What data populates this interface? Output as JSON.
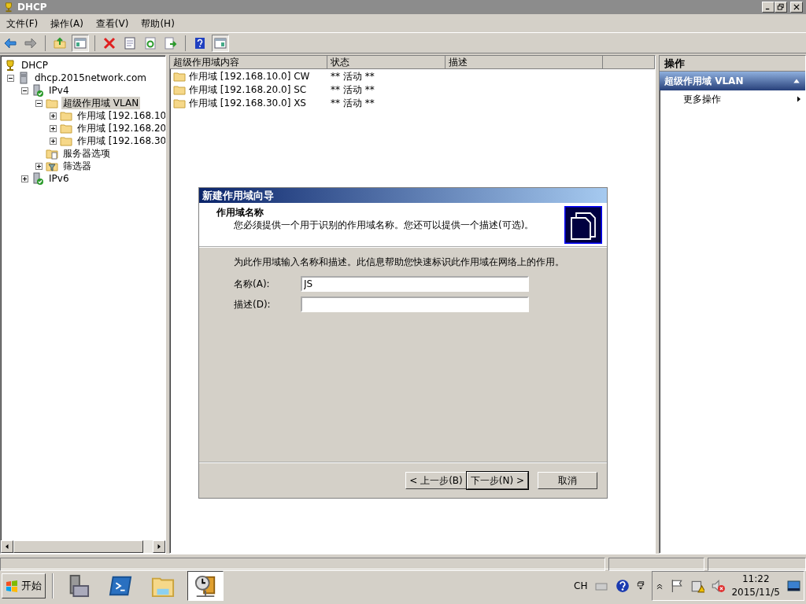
{
  "window": {
    "title": "DHCP"
  },
  "menu": [
    {
      "label": "文件(F)"
    },
    {
      "label": "操作(A)"
    },
    {
      "label": "查看(V)"
    },
    {
      "label": "帮助(H)"
    }
  ],
  "toolbar": [
    {
      "kind": "back",
      "on": false
    },
    {
      "kind": "forward",
      "on": false
    },
    {
      "kind": "up",
      "on": false
    },
    {
      "kind": "tree",
      "on": true
    },
    {
      "kind": "delete",
      "on": false
    },
    {
      "kind": "properties",
      "on": false
    },
    {
      "kind": "refresh",
      "on": false
    },
    {
      "kind": "export",
      "on": false
    },
    {
      "kind": "help",
      "on": false
    },
    {
      "kind": "pane",
      "on": true
    }
  ],
  "tree": [
    {
      "label": "DHCP",
      "kind": "dhcp",
      "selected": false,
      "children": [
        {
          "label": "dhcp.2015network.com",
          "kind": "server",
          "expanded": true,
          "selected": false,
          "children": [
            {
              "label": "IPv4",
              "kind": "protocol",
              "expanded": true,
              "selected": false,
              "children": [
                {
                  "label": "超级作用域 VLAN",
                  "kind": "folder",
                  "expanded": true,
                  "selected": true,
                  "children": [
                    {
                      "label": "作用域 [192.168.10",
                      "kind": "folder",
                      "expanded": false,
                      "selected": false
                    },
                    {
                      "label": "作用域 [192.168.20",
                      "kind": "folder",
                      "expanded": false,
                      "selected": false
                    },
                    {
                      "label": "作用域 [192.168.30",
                      "kind": "folder",
                      "expanded": false,
                      "selected": false
                    }
                  ]
                },
                {
                  "label": "服务器选项",
                  "kind": "options",
                  "selected": false
                },
                {
                  "label": "筛选器",
                  "kind": "filter",
                  "expanded": false,
                  "selected": false
                }
              ]
            },
            {
              "label": "IPv6",
              "kind": "protocol",
              "expanded": false,
              "selected": false
            }
          ]
        }
      ]
    }
  ],
  "list": {
    "columns": [
      "超级作用域内容",
      "状态",
      "描述"
    ],
    "rows": [
      {
        "name": "作用域 [192.168.10.0] CW",
        "status": "** 活动 **"
      },
      {
        "name": "作用域 [192.168.20.0] SC",
        "status": "** 活动 **"
      },
      {
        "name": "作用域 [192.168.30.0] XS",
        "status": "** 活动 **"
      }
    ]
  },
  "actions": {
    "title": "操作",
    "section": {
      "label": "超级作用域 VLAN",
      "expanded": true
    },
    "items": [
      {
        "label": "更多操作"
      }
    ]
  },
  "dialog": {
    "title": "新建作用域向导",
    "heading": "作用域名称",
    "subheading": "您必须提供一个用于识别的作用域名称。您还可以提供一个描述(可选)。",
    "intro": "为此作用域输入名称和描述。此信息帮助您快速标识此作用域在网络上的作用。",
    "fields": [
      {
        "label": "名称(A):",
        "value": "JS"
      },
      {
        "label": "描述(D):"
      }
    ],
    "buttons": [
      {
        "label": "< 上一步(B)",
        "default": false
      },
      {
        "label": "下一步(N) >",
        "default": true
      },
      {
        "label": "取消",
        "default": false
      }
    ]
  },
  "taskbar": {
    "start": "开始",
    "apps": [
      {
        "kind": "toolbox",
        "selected": false
      },
      {
        "kind": "terminal",
        "selected": false
      },
      {
        "kind": "explorer",
        "selected": false
      },
      {
        "kind": "dhcp",
        "selected": true
      }
    ],
    "language": "CH",
    "time": "11:22",
    "date": "2015/11/5"
  }
}
